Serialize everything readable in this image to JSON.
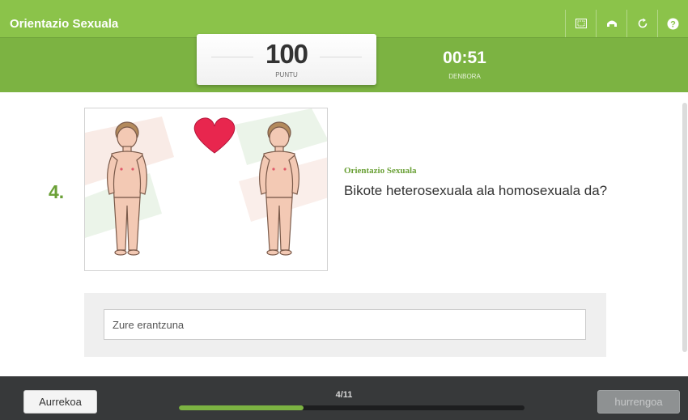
{
  "app": {
    "title": "Orientazio Sexuala"
  },
  "toolbar": {
    "icons": [
      "fullscreen-icon",
      "print-icon",
      "restart-icon",
      "help-icon"
    ]
  },
  "score": {
    "value": "100",
    "label": "PUNTU"
  },
  "timer": {
    "value": "00:51",
    "label": "DENBORA"
  },
  "question": {
    "number": "4.",
    "category": "Orientazio Sexuala",
    "text": "Bikote heterosexuala ala homosexuala da?"
  },
  "answer": {
    "placeholder": "Zure erantzuna",
    "value": ""
  },
  "footer": {
    "prev_label": "Aurrekoa",
    "next_label": "hurrengoa",
    "progress_text": "4/11",
    "progress_fraction": 0.36
  },
  "colors": {
    "header_green": "#7cb342",
    "accent_green": "#6aa036",
    "footer_dark": "#37393a"
  }
}
